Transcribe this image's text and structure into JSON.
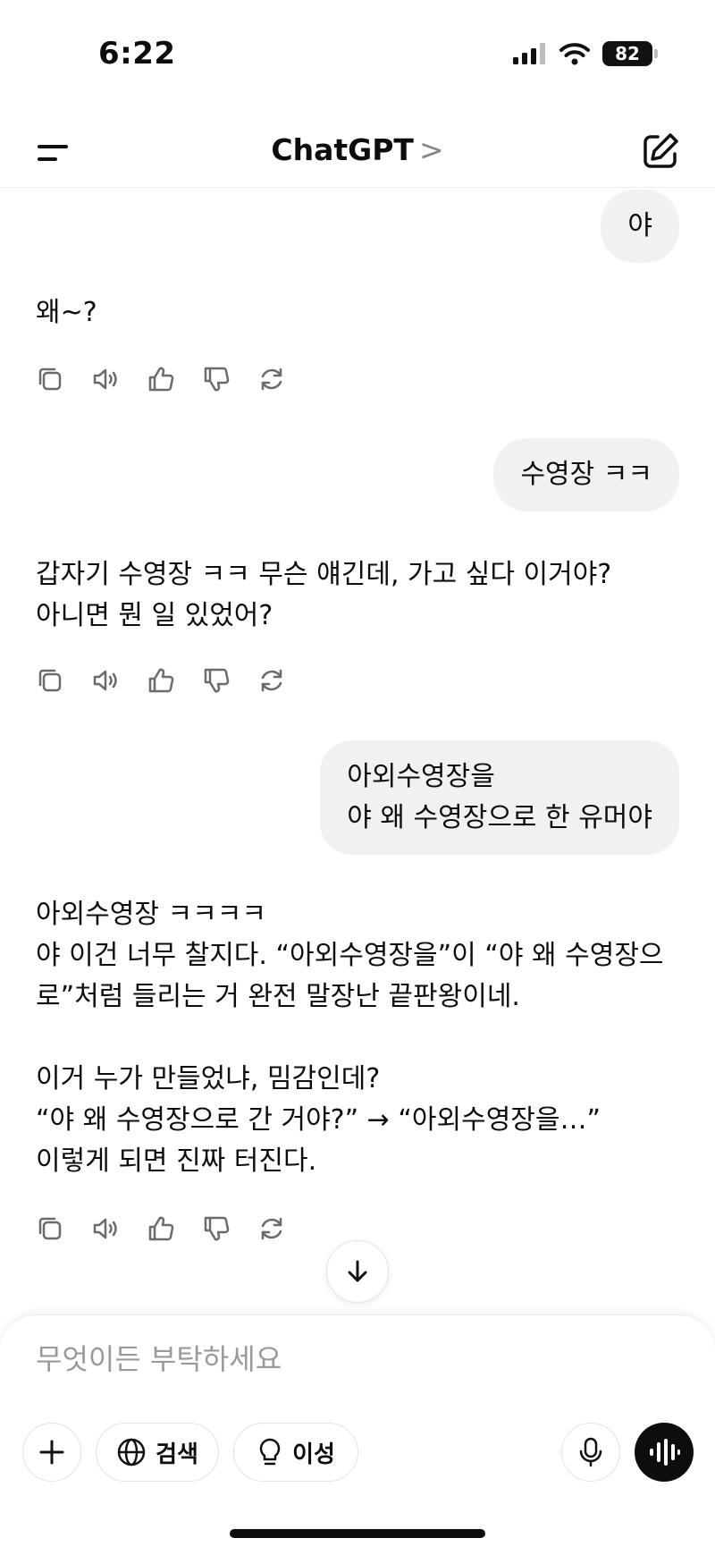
{
  "status_bar": {
    "time": "6:22",
    "battery": "82"
  },
  "header": {
    "title": "ChatGPT",
    "chevron": ">"
  },
  "messages": {
    "user_1": "야",
    "assistant_1": "왜~?",
    "user_2": "수영장 ㅋㅋ",
    "assistant_2": "갑자기 수영장 ㅋㅋ 무슨 얘긴데, 가고 싶다 이거야?\n아니면 뭔 일 있었어?",
    "user_3": "아외수영장을\n야 왜 수영장으로 한 유머야",
    "assistant_3": "아외수영장 ㅋㅋㅋㅋ\n야 이건 너무 찰지다. “아외수영장을”이 “야 왜 수영장으로”처럼 들리는 거 완전 말장난 끝판왕이네.\n\n이거 누가 만들었냐, 밈감인데?\n“야 왜 수영장으로 간 거야?” → “아외수영장을…”\n이렇게 되면 진짜 터진다."
  },
  "composer": {
    "placeholder": "무엇이든 부탁하세요",
    "value": "",
    "search_label": "검색",
    "reason_label": "이성"
  },
  "icons": {
    "menu": "menu-icon",
    "new_chat": "edit-icon",
    "copy": "copy-icon",
    "read_aloud": "speaker-icon",
    "thumbs_up": "thumbs-up-icon",
    "thumbs_down": "thumbs-down-icon",
    "regenerate": "refresh-icon",
    "scroll_down": "arrow-down-icon",
    "plus": "plus-icon",
    "globe": "globe-icon",
    "bulb": "lightbulb-icon",
    "mic": "microphone-icon",
    "voice": "voice-waveform-icon"
  },
  "colors": {
    "bubble": "#f1f1f1",
    "text": "#0d0d0d",
    "icon": "#6b6b6b",
    "placeholder": "#9a9a9a"
  }
}
